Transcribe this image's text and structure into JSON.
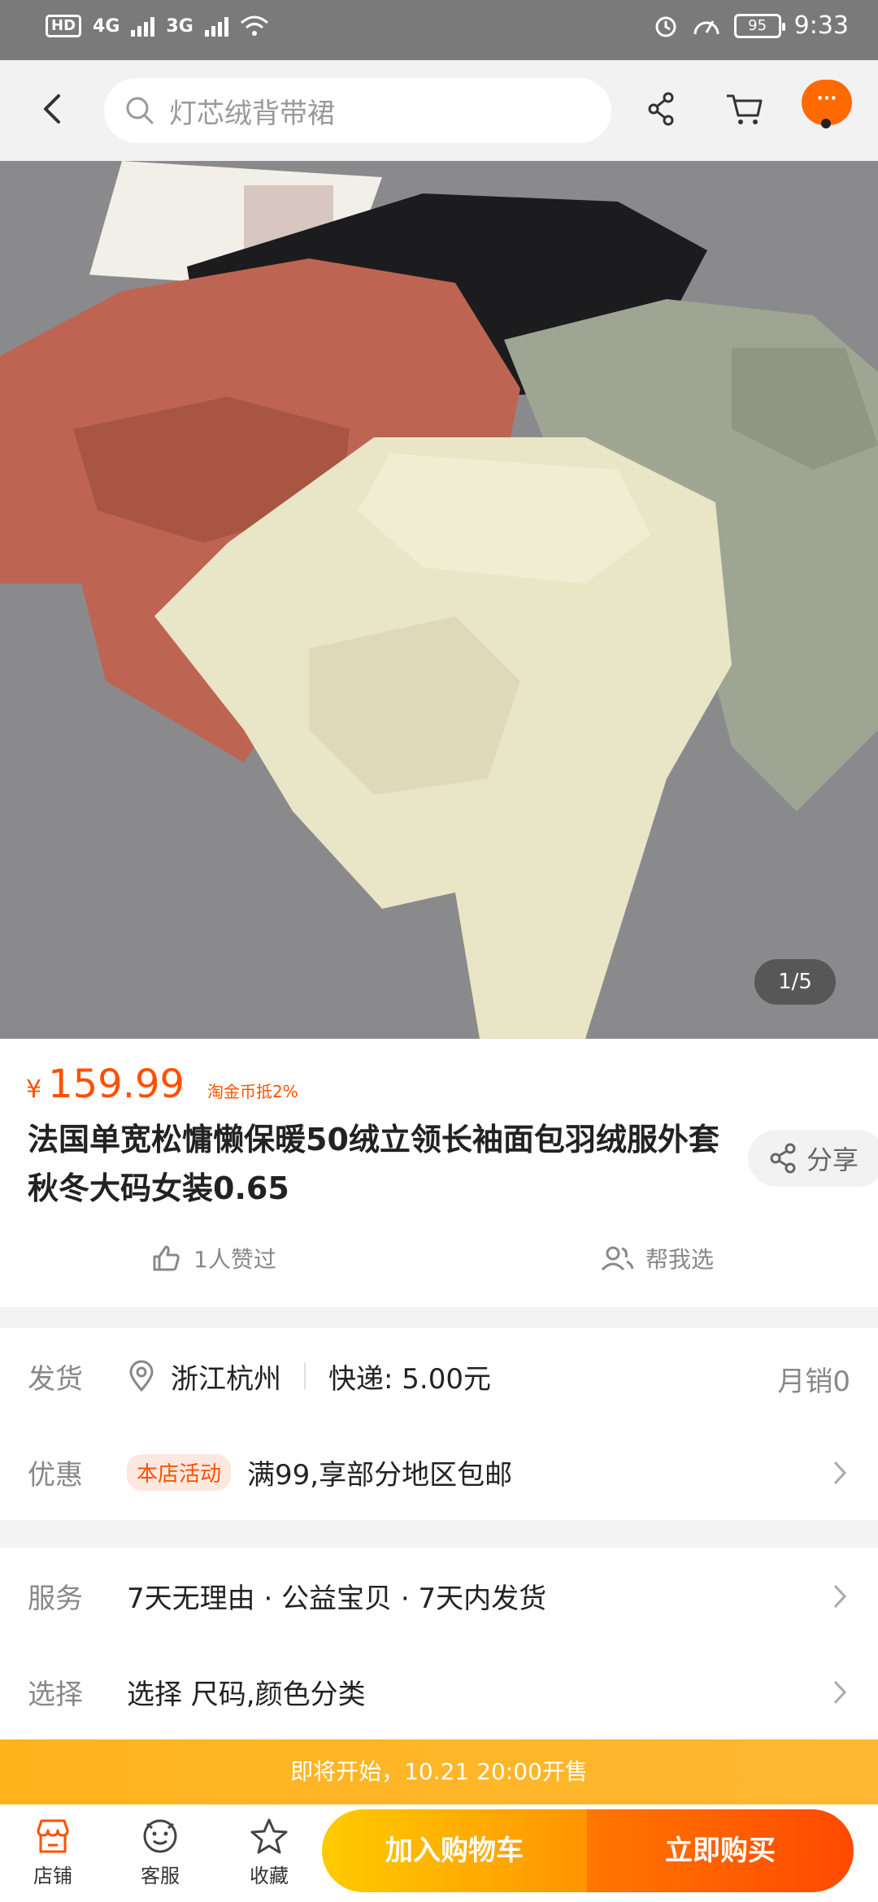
{
  "status_bar": {
    "hd": "HD",
    "sim1": "4G",
    "sim2": "3G",
    "battery": "95",
    "time": "9:33"
  },
  "header": {
    "search_placeholder": "灯芯绒背带裙",
    "more_label": "···"
  },
  "gallery": {
    "counter": "1/5"
  },
  "product": {
    "currency": "¥",
    "price": "159.99",
    "coin_note": "淘金币抵2%",
    "title": "法国单宽松慵懒保暖50绒立领长袖面包羽绒服外套秋冬大码女装0.65",
    "share_label": "分享",
    "likes_label": "1人赞过",
    "help_choose_label": "帮我选"
  },
  "shipping": {
    "label": "发货",
    "location": "浙江杭州",
    "express": "快递: 5.00元",
    "monthly_sales": "月销0"
  },
  "promo": {
    "label": "优惠",
    "tag": "本店活动",
    "text": "满99,享部分地区包邮"
  },
  "service": {
    "label": "服务",
    "text": "7天无理由 · 公益宝贝 · 7天内发货"
  },
  "select": {
    "label": "选择",
    "text": "选择 尺码,颜色分类"
  },
  "banner": {
    "text": "即将开始，10.21 20:00开售"
  },
  "bottom_bar": {
    "shop": "店铺",
    "service": "客服",
    "favorite": "收藏",
    "add_to_cart": "加入购物车",
    "buy_now": "立即购买"
  },
  "colors": {
    "accent": "#ff5000",
    "cart_button": "#ffb300",
    "buy_button": "#ff5a00",
    "banner": "#ffb41c"
  }
}
